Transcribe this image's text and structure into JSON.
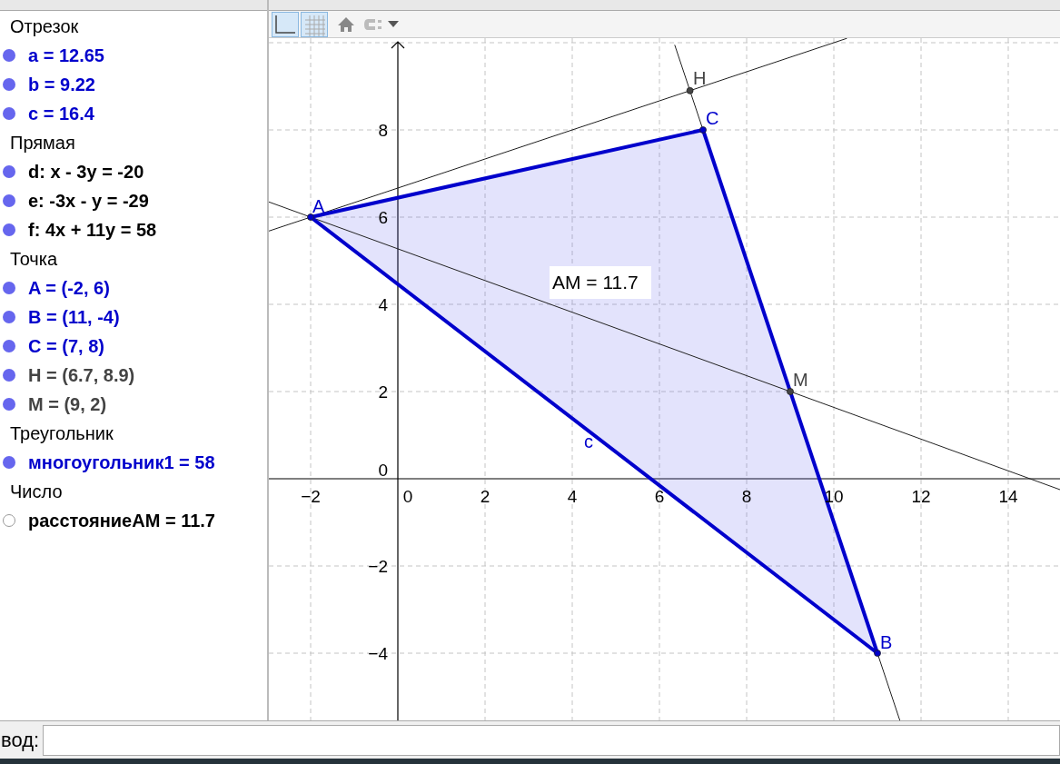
{
  "algebra_panel": {
    "groups": [
      {
        "title": "Отрезок",
        "children": [
          {
            "text": "a = 12.65",
            "color": "#0000cc",
            "visible": true
          },
          {
            "text": "b = 9.22",
            "color": "#0000cc",
            "visible": true
          },
          {
            "text": "c = 16.4",
            "color": "#0000cc",
            "visible": true
          }
        ]
      },
      {
        "title": "Прямая",
        "children": [
          {
            "text": "d: x - 3y = -20",
            "color": "#000000",
            "visible": true
          },
          {
            "text": "e: -3x - y = -29",
            "color": "#000000",
            "visible": true
          },
          {
            "text": "f: 4x + 11y = 58",
            "color": "#000000",
            "visible": true
          }
        ]
      },
      {
        "title": "Точка",
        "children": [
          {
            "text": "A = (-2, 6)",
            "color": "#0000cc",
            "visible": true
          },
          {
            "text": "B = (11, -4)",
            "color": "#0000cc",
            "visible": true
          },
          {
            "text": "C = (7, 8)",
            "color": "#0000cc",
            "visible": true
          },
          {
            "text": "H = (6.7, 8.9)",
            "color": "#444444",
            "visible": true
          },
          {
            "text": "M = (9, 2)",
            "color": "#444444",
            "visible": true
          }
        ]
      },
      {
        "title": "Треугольник",
        "children": [
          {
            "text": "многоугольник1 = 58",
            "color": "#0000cc",
            "visible": true
          }
        ]
      },
      {
        "title": "Число",
        "children": [
          {
            "text": "расстояниеAM = 11.7",
            "color": "#000000",
            "visible": false
          }
        ]
      }
    ]
  },
  "toolbar": {
    "buttons": [
      {
        "selected": true
      },
      {
        "selected": true
      }
    ]
  },
  "canvas": {
    "x_ticks": [
      "−2",
      "0",
      "2",
      "4",
      "6",
      "8",
      "10",
      "12",
      "14"
    ],
    "y_ticks": [
      "8",
      "6",
      "4",
      "2",
      "0",
      "−2",
      "−4"
    ],
    "point_labels": [
      "A",
      "H",
      "C",
      "M",
      "B"
    ],
    "segment_label": "c",
    "distance_label": "AM = 11.7"
  },
  "input_bar": {
    "label": "вод:"
  }
}
